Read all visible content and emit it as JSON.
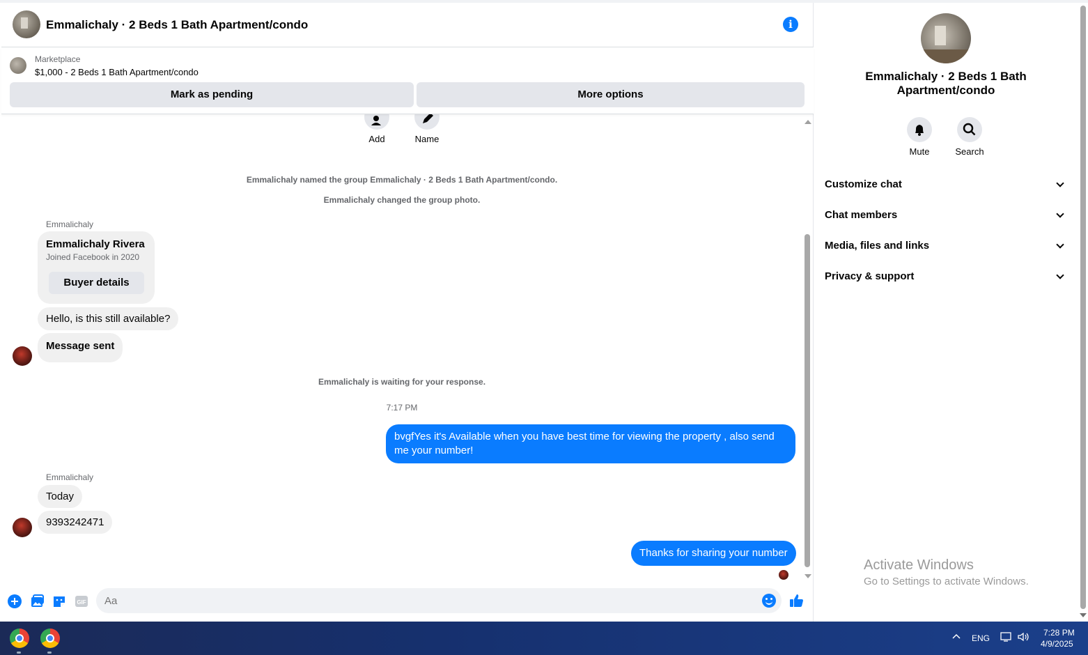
{
  "chat": {
    "title": "Emmalichaly · 2 Beds 1 Bath Apartment/condo",
    "listing": {
      "source": "Marketplace",
      "price_title": "$1,000 - 2 Beds 1 Bath Apartment/condo",
      "pending_label": "Mark as pending",
      "more_label": "More options"
    },
    "actions": {
      "add": "Add",
      "name": "Name"
    },
    "system": {
      "named": "Emmalichaly named the group Emmalichaly · 2 Beds 1 Bath Apartment/condo.",
      "photo": "Emmalichaly changed the group photo.",
      "waiting": "Emmalichaly is waiting for your response.",
      "time": "7:17 PM"
    },
    "sender1": "Emmalichaly",
    "card": {
      "name": "Emmalichaly Rivera",
      "sub": "Joined Facebook in 2020",
      "button": "Buyer details"
    },
    "msg_hello": "Hello, is this still available?",
    "msg_sent": "Message sent",
    "msg_out1": "bvgfYes it's Available when you have best time for viewing the property , also send me your number!",
    "sender2": "Emmalichaly",
    "msg_today": "Today",
    "msg_number": "9393242471",
    "msg_out2": "Thanks for sharing your number",
    "composer_placeholder": "Aa"
  },
  "side": {
    "title": "Emmalichaly · 2 Beds 1 Bath Apartment/condo",
    "mute": "Mute",
    "search": "Search",
    "menu": [
      "Customize chat",
      "Chat members",
      "Media, files and links",
      "Privacy & support"
    ],
    "activate_title": "Activate Windows",
    "activate_sub": "Go to Settings to activate Windows."
  },
  "taskbar": {
    "lang": "ENG",
    "time": "7:28 PM",
    "date": "4/9/2025"
  },
  "colors": {
    "accent": "#0a7cff",
    "bubble_in": "#f0f0f0"
  }
}
